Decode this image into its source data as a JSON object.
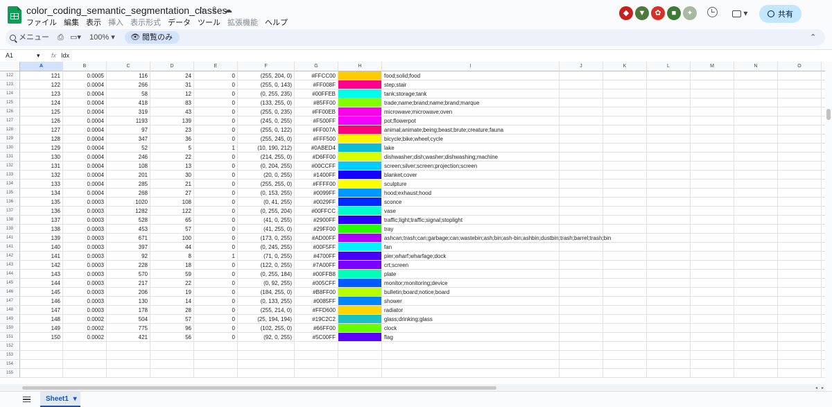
{
  "app": {
    "title": "color_coding_semantic_segmentation_classes",
    "menus": [
      "ファイル",
      "編集",
      "表示",
      "挿入",
      "表示形式",
      "データ",
      "ツール",
      "拡張機能",
      "ヘルプ"
    ],
    "share_label": "共有",
    "search_label": "メニュー",
    "zoom": "100%",
    "view_only_label": "閲覧のみ",
    "avatar_colors": [
      "#c5221f",
      "#4e7b3c",
      "#d93025",
      "#3d7a35",
      "#a9b8a0"
    ]
  },
  "formula_bar": {
    "cell_ref": "A1",
    "fx": "fx",
    "value": "Idx"
  },
  "grid": {
    "columns": [
      "A",
      "B",
      "C",
      "D",
      "E",
      "F",
      "G",
      "H",
      "I",
      "J",
      "K",
      "L",
      "M",
      "N",
      "O",
      "P"
    ],
    "rows": [
      {
        "n": "122",
        "a": "121",
        "b": "0.0005",
        "c": "116",
        "d": "24",
        "e": "0",
        "f": "(255, 204, 0)",
        "g": "#FFCC00",
        "color": "#FFCC00",
        "i": "food;solid;food"
      },
      {
        "n": "123",
        "a": "122",
        "b": "0.0004",
        "c": "266",
        "d": "31",
        "e": "0",
        "f": "(255, 0, 143)",
        "g": "#FF008F",
        "color": "#FF008F",
        "i": "step;stair"
      },
      {
        "n": "124",
        "a": "123",
        "b": "0.0004",
        "c": "58",
        "d": "12",
        "e": "0",
        "f": "(0, 255, 235)",
        "g": "#00FFEB",
        "color": "#00FFEB",
        "i": "tank;storage;tank"
      },
      {
        "n": "125",
        "a": "124",
        "b": "0.0004",
        "c": "418",
        "d": "83",
        "e": "0",
        "f": "(133, 255, 0)",
        "g": "#85FF00",
        "color": "#85FF00",
        "i": "trade;name;brand;name;brand;marque"
      },
      {
        "n": "126",
        "a": "125",
        "b": "0.0004",
        "c": "319",
        "d": "43",
        "e": "0",
        "f": "(255, 0, 235)",
        "g": "#FF00EB",
        "color": "#FF00EB",
        "i": "microwave;microwave;oven"
      },
      {
        "n": "127",
        "a": "126",
        "b": "0.0004",
        "c": "1193",
        "d": "139",
        "e": "0",
        "f": "(245, 0, 255)",
        "g": "#F500FF",
        "color": "#F500FF",
        "i": "pot;flowerpot"
      },
      {
        "n": "128",
        "a": "127",
        "b": "0.0004",
        "c": "97",
        "d": "23",
        "e": "0",
        "f": "(255, 0, 122)",
        "g": "#FF007A",
        "color": "#FF007A",
        "i": "animal;animate;being;beast;brute;creature;fauna"
      },
      {
        "n": "129",
        "a": "128",
        "b": "0.0004",
        "c": "347",
        "d": "36",
        "e": "0",
        "f": "(255, 245, 0)",
        "g": "#FFF500",
        "color": "#FFF500",
        "i": "bicycle;bike;wheel;cycle"
      },
      {
        "n": "130",
        "a": "129",
        "b": "0.0004",
        "c": "52",
        "d": "5",
        "e": "1",
        "f": "(10, 190, 212)",
        "g": "#0ABED4",
        "color": "#0ABED4",
        "i": "lake"
      },
      {
        "n": "131",
        "a": "130",
        "b": "0.0004",
        "c": "246",
        "d": "22",
        "e": "0",
        "f": "(214, 255, 0)",
        "g": "#D6FF00",
        "color": "#D6FF00",
        "i": "dishwasher;dish;washer;dishwashing;machine"
      },
      {
        "n": "132",
        "a": "131",
        "b": "0.0004",
        "c": "108",
        "d": "13",
        "e": "0",
        "f": "(0, 204, 255)",
        "g": "#00CCFF",
        "color": "#00CCFF",
        "i": "screen;silver;screen;projection;screen"
      },
      {
        "n": "133",
        "a": "132",
        "b": "0.0004",
        "c": "201",
        "d": "30",
        "e": "0",
        "f": "(20, 0, 255)",
        "g": "#1400FF",
        "color": "#1400FF",
        "i": "blanket;cover"
      },
      {
        "n": "134",
        "a": "133",
        "b": "0.0004",
        "c": "285",
        "d": "21",
        "e": "0",
        "f": "(255, 255, 0)",
        "g": "#FFFF00",
        "color": "#FFFF00",
        "i": "sculpture"
      },
      {
        "n": "135",
        "a": "134",
        "b": "0.0004",
        "c": "268",
        "d": "27",
        "e": "0",
        "f": "(0, 153, 255)",
        "g": "#0099FF",
        "color": "#0099FF",
        "i": "hood;exhaust;hood"
      },
      {
        "n": "136",
        "a": "135",
        "b": "0.0003",
        "c": "1020",
        "d": "108",
        "e": "0",
        "f": "(0, 41, 255)",
        "g": "#0029FF",
        "color": "#0029FF",
        "i": "sconce"
      },
      {
        "n": "137",
        "a": "136",
        "b": "0.0003",
        "c": "1282",
        "d": "122",
        "e": "0",
        "f": "(0, 255, 204)",
        "g": "#00FFCC",
        "color": "#00FFCC",
        "i": "vase"
      },
      {
        "n": "138",
        "a": "137",
        "b": "0.0003",
        "c": "528",
        "d": "65",
        "e": "0",
        "f": "(41, 0, 255)",
        "g": "#2900FF",
        "color": "#2900FF",
        "i": "traffic;light;traffic;signal;stoplight"
      },
      {
        "n": "139",
        "a": "138",
        "b": "0.0003",
        "c": "453",
        "d": "57",
        "e": "0",
        "f": "(41, 255, 0)",
        "g": "#29FF00",
        "color": "#29FF00",
        "i": "tray"
      },
      {
        "n": "141",
        "a": "139",
        "b": "0.0003",
        "c": "671",
        "d": "100",
        "e": "0",
        "f": "(173, 0, 255)",
        "g": "#AD00FF",
        "color": "#AD00FF",
        "i": "ashcan;trash;can;garbage;can;wastebin;ash;bin;ash-bin;ashbin;dustbin;trash;barrel;trash;bin"
      },
      {
        "n": "141",
        "a": "140",
        "b": "0.0003",
        "c": "397",
        "d": "44",
        "e": "0",
        "f": "(0, 245, 255)",
        "g": "#00F5FF",
        "color": "#00F5FF",
        "i": "fan"
      },
      {
        "n": "142",
        "a": "141",
        "b": "0.0003",
        "c": "92",
        "d": "8",
        "e": "1",
        "f": "(71, 0, 255)",
        "g": "#4700FF",
        "color": "#4700FF",
        "i": "pier;wharf;wharfage;dock"
      },
      {
        "n": "143",
        "a": "142",
        "b": "0.0003",
        "c": "228",
        "d": "18",
        "e": "0",
        "f": "(122, 0, 255)",
        "g": "#7A00FF",
        "color": "#7A00FF",
        "i": "crt;screen"
      },
      {
        "n": "144",
        "a": "143",
        "b": "0.0003",
        "c": "570",
        "d": "59",
        "e": "0",
        "f": "(0, 255, 184)",
        "g": "#00FFB8",
        "color": "#00FFB8",
        "i": "plate"
      },
      {
        "n": "145",
        "a": "144",
        "b": "0.0003",
        "c": "217",
        "d": "22",
        "e": "0",
        "f": "(0, 92, 255)",
        "g": "#005CFF",
        "color": "#005CFF",
        "i": "monitor;monitoring;device"
      },
      {
        "n": "146",
        "a": "145",
        "b": "0.0003",
        "c": "206",
        "d": "19",
        "e": "0",
        "f": "(184, 255, 0)",
        "g": "#B8FF00",
        "color": "#B8FF00",
        "i": "bulletin;board;notice;board"
      },
      {
        "n": "147",
        "a": "146",
        "b": "0.0003",
        "c": "130",
        "d": "14",
        "e": "0",
        "f": "(0, 133, 255)",
        "g": "#0085FF",
        "color": "#0085FF",
        "i": "shower"
      },
      {
        "n": "148",
        "a": "147",
        "b": "0.0003",
        "c": "178",
        "d": "28",
        "e": "0",
        "f": "(255, 214, 0)",
        "g": "#FFD600",
        "color": "#FFD600",
        "i": "radiator"
      },
      {
        "n": "149",
        "a": "148",
        "b": "0.0002",
        "c": "504",
        "d": "57",
        "e": "0",
        "f": "(25, 194, 194)",
        "g": "#19C2C2",
        "color": "#19C2C2",
        "i": "glass;drinking;glass"
      },
      {
        "n": "150",
        "a": "149",
        "b": "0.0002",
        "c": "775",
        "d": "96",
        "e": "0",
        "f": "(102, 255, 0)",
        "g": "#66FF00",
        "color": "#66FF00",
        "i": "clock"
      },
      {
        "n": "151",
        "a": "150",
        "b": "0.0002",
        "c": "421",
        "d": "56",
        "e": "0",
        "f": "(92, 0, 255)",
        "g": "#5C00FF",
        "color": "#5C00FF",
        "i": "flag"
      },
      {
        "n": "152"
      },
      {
        "n": "153"
      },
      {
        "n": "154"
      },
      {
        "n": "155"
      }
    ]
  },
  "sheets": [
    "Sheet1"
  ]
}
